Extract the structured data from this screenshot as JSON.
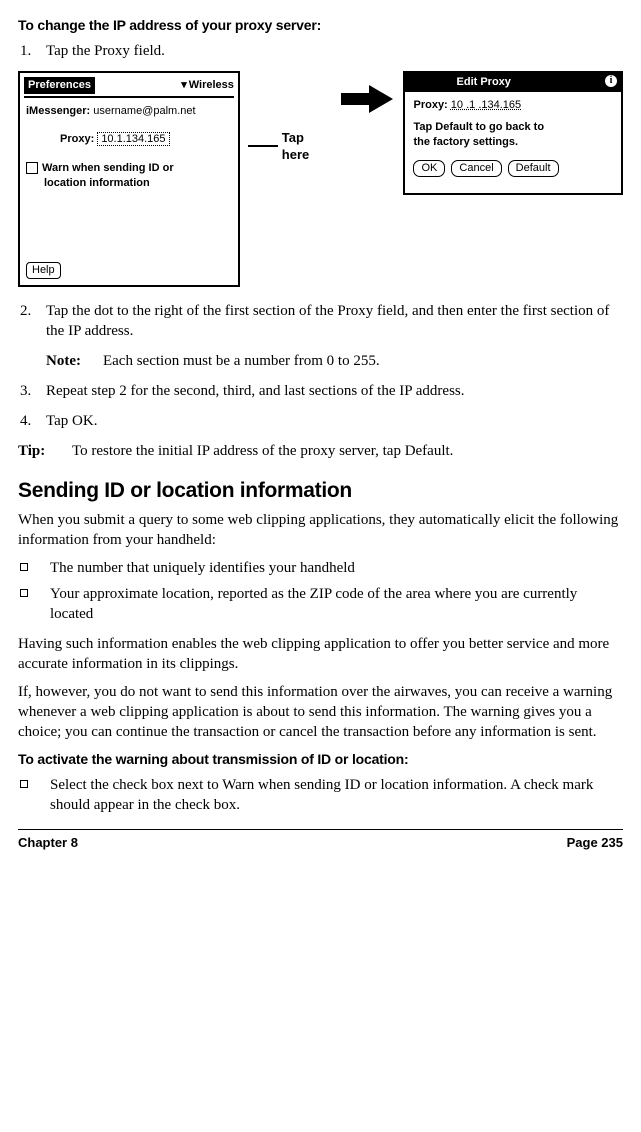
{
  "headings": {
    "proc1": "To change the IP address of your proxy server:",
    "section": "Sending ID or location information",
    "proc2": "To activate the warning about transmission of ID or location:"
  },
  "steps": {
    "s1": "Tap the Proxy field.",
    "s2": "Tap the dot to the right of the first section of the Proxy field, and then enter the first section of the IP address.",
    "s3": "Repeat step 2 for the second, third, and last sections of the IP address.",
    "s4": "Tap OK."
  },
  "note": {
    "label": "Note:",
    "text": "Each section must be a number from 0 to 255."
  },
  "tip": {
    "label": "Tip:",
    "text": "To restore the initial IP address of the proxy server, tap Default."
  },
  "figure": {
    "prefs": {
      "title": "Preferences",
      "dropdown": "Wireless",
      "imessenger_label": "iMessenger:",
      "imessenger_value": "username@palm.net",
      "proxy_label": "Proxy:",
      "proxy_value": "10.1.134.165",
      "warn_line1": "Warn when sending ID or",
      "warn_line2": "location information",
      "help": "Help"
    },
    "callout": "Tap here",
    "edit": {
      "title": "Edit Proxy",
      "info": "i",
      "proxy_label": "Proxy:",
      "proxy_value": "10 .1    .134.165",
      "msg_line1": "Tap Default to go back to",
      "msg_line2": "the factory settings.",
      "btn_ok": "OK",
      "btn_cancel": "Cancel",
      "btn_default": "Default"
    }
  },
  "paras": {
    "p1": "When you submit a query to some web clipping applications, they automatically elicit the following information from your handheld:",
    "p2": "Having such information enables the web clipping application to offer you better service and more accurate information in its clippings.",
    "p3": "If, however, you do not want to send this information over the airwaves, you can receive a warning whenever a web clipping application is about to send this information. The warning gives you a choice; you can continue the transaction or cancel the transaction before any information is sent."
  },
  "bullets": {
    "b1": "The number that uniquely identifies your handheld",
    "b2": "Your approximate location, reported as the ZIP code of the area where you are currently located",
    "b3": "Select the check box next to Warn when sending ID or location information. A check mark should appear in the check box."
  },
  "footer": {
    "left": "Chapter 8",
    "right": "Page 235"
  }
}
